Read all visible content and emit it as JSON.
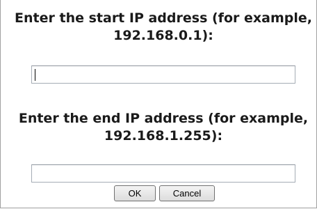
{
  "dialog": {
    "start_prompt": "Enter the start IP address (for example, 192.168.0.1):",
    "start_value": "",
    "end_prompt": "Enter the end IP address (for example, 192.168.1.255):",
    "end_value": "",
    "ok_label": "OK",
    "cancel_label": "Cancel"
  }
}
